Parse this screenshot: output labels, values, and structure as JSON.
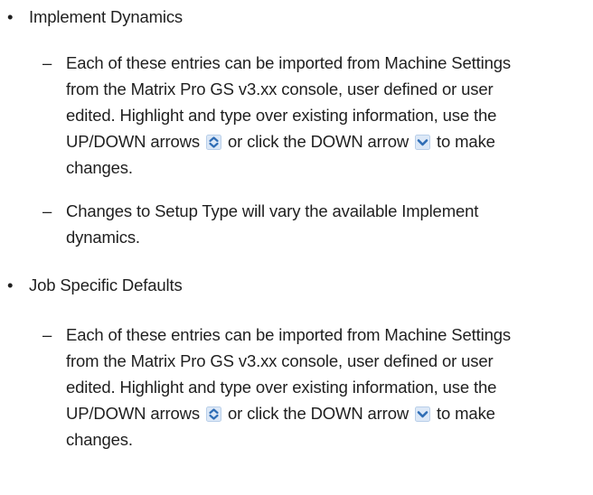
{
  "sections": [
    {
      "bullet": "•",
      "title": "Implement Dynamics",
      "items": [
        {
          "dash": "–",
          "lines": [
            "Each of these entries can be imported from Machine Settings",
            "from the Matrix Pro GS v3.xx console, user defined or user",
            "edited. Highlight and type over existing information, use the"
          ],
          "icon_line": {
            "before": "UP/DOWN arrows",
            "middle": "or click the DOWN arrow",
            "after": "to make"
          },
          "last_line": "changes."
        },
        {
          "dash": "–",
          "lines": [
            "Changes to Setup Type will vary the available Implement",
            "dynamics."
          ]
        }
      ]
    },
    {
      "bullet": "•",
      "title": "Job Specific Defaults",
      "items": [
        {
          "dash": "–",
          "lines": [
            "Each of these entries can be imported from Machine Settings",
            "from the Matrix Pro GS v3.xx console, user defined or user",
            "edited. Highlight and type over existing information, use the"
          ],
          "icon_line": {
            "before": "UP/DOWN arrows",
            "middle": "or click the DOWN arrow",
            "after": "to make"
          },
          "last_line": "changes."
        }
      ]
    }
  ],
  "icons": {
    "updown": "up-down-arrows-icon",
    "down": "down-arrow-icon"
  },
  "colors": {
    "text": "#1f1f1f",
    "icon_bg": "#dce8f7",
    "icon_arrow": "#2f6db5"
  }
}
